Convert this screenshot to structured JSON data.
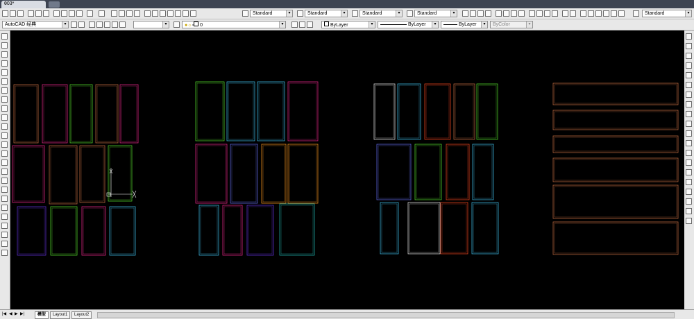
{
  "window": {
    "tab_title": "003*"
  },
  "toolbar1": {
    "text_style": "Standard",
    "dim_style": "Standard",
    "table_style": "Standard",
    "mleader_style": "Standard",
    "right_style": "Standard"
  },
  "toolbar2": {
    "workspace": "AutoCAD 经典",
    "layer": "0",
    "color": "ByLayer",
    "linetype": "ByLayer",
    "lineweight": "ByLayer",
    "plotstyle": "ByColor"
  },
  "layout_tabs": [
    "模型",
    "Layout1",
    "Layout2"
  ],
  "colors": {
    "brown": "#b5643c",
    "magenta": "#d6257f",
    "green": "#4ecb2a",
    "cyan": "#3ab0d8",
    "blue": "#5a62d8",
    "purple": "#5a2fc8",
    "orange": "#e88a1c",
    "red": "#e0401c",
    "white": "#d8d8d8",
    "teal": "#1fa6a0"
  }
}
